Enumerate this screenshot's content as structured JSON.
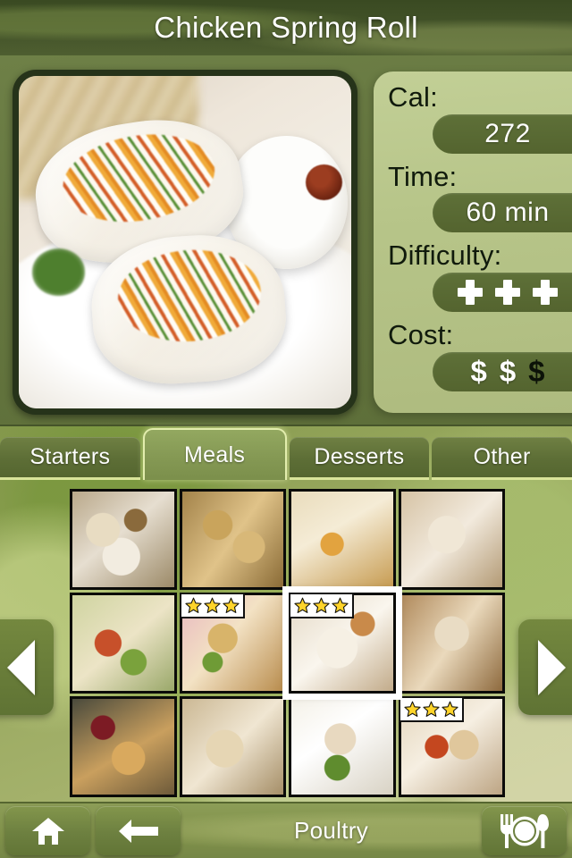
{
  "header": {
    "title": "Chicken Spring Roll"
  },
  "recipe": {
    "photo_alt": "chicken-spring-roll-photo",
    "info": [
      {
        "label": "Cal:",
        "value": "272",
        "type": "text"
      },
      {
        "label": "Time:",
        "value": "60 min",
        "type": "text"
      },
      {
        "label": "Difficulty:",
        "value": "+ + +",
        "type": "plus",
        "filled": 3,
        "total": 3
      },
      {
        "label": "Cost:",
        "value": "$ $ $",
        "type": "dollar",
        "filled": 2,
        "total": 3
      }
    ]
  },
  "tabs": [
    {
      "label": "Starters",
      "active": false
    },
    {
      "label": "Meals",
      "active": true
    },
    {
      "label": "Desserts",
      "active": false
    },
    {
      "label": "Other",
      "active": false
    }
  ],
  "grid": {
    "columns": 4,
    "rows": 3,
    "items": [
      {
        "name": "chicken-with-potatoes",
        "swatch": "f1",
        "stars": null,
        "selected": false
      },
      {
        "name": "herb-crusted-chicken",
        "swatch": "f2",
        "stars": null,
        "selected": false
      },
      {
        "name": "chicken-wrap-platter",
        "swatch": "f3",
        "stars": null,
        "selected": false
      },
      {
        "name": "stuffed-chicken-slices",
        "swatch": "f4",
        "stars": null,
        "selected": false
      },
      {
        "name": "chicken-with-pasta",
        "swatch": "f5",
        "stars": null,
        "selected": false
      },
      {
        "name": "breaded-chicken-strips",
        "swatch": "f6",
        "stars": 3,
        "selected": false
      },
      {
        "name": "chicken-spring-roll",
        "swatch": "f7",
        "stars": 3,
        "selected": true
      },
      {
        "name": "stuffed-chicken-roast",
        "swatch": "f8",
        "stars": null,
        "selected": false
      },
      {
        "name": "whole-roast-chicken",
        "swatch": "f9",
        "stars": null,
        "selected": false
      },
      {
        "name": "grilled-chicken-panini",
        "swatch": "f10",
        "stars": null,
        "selected": false
      },
      {
        "name": "sliced-turkey-plate",
        "swatch": "f11",
        "stars": null,
        "selected": false
      },
      {
        "name": "chicken-tortilla-wraps",
        "swatch": "f12",
        "stars": 3,
        "selected": false
      }
    ]
  },
  "nav": {
    "prev_label": "◀",
    "next_label": "▶"
  },
  "bottom": {
    "home_label": "home-icon",
    "back_label": "back-arrow-icon",
    "category": "Poultry",
    "cutlery_label": "cutlery-icon"
  },
  "colors": {
    "header_bg": "#44542a",
    "panel_bg": "#65763f",
    "info_card": "#b7c589",
    "pill": "#5e7038",
    "tab_active": "#869a55",
    "tab_active_border": "#e2edad",
    "tab_inactive": "#5d6e36",
    "star": "#ffd42a",
    "accent_white": "#ffffff",
    "bottom_bar": "#7f9049"
  }
}
